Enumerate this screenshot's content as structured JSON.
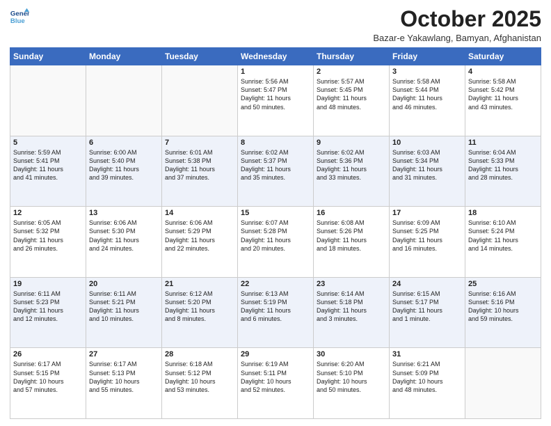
{
  "header": {
    "logo_line1": "General",
    "logo_line2": "Blue",
    "month": "October 2025",
    "location": "Bazar-e Yakawlang, Bamyan, Afghanistan"
  },
  "weekdays": [
    "Sunday",
    "Monday",
    "Tuesday",
    "Wednesday",
    "Thursday",
    "Friday",
    "Saturday"
  ],
  "weeks": [
    [
      {
        "day": "",
        "info": ""
      },
      {
        "day": "",
        "info": ""
      },
      {
        "day": "",
        "info": ""
      },
      {
        "day": "1",
        "info": "Sunrise: 5:56 AM\nSunset: 5:47 PM\nDaylight: 11 hours\nand 50 minutes."
      },
      {
        "day": "2",
        "info": "Sunrise: 5:57 AM\nSunset: 5:45 PM\nDaylight: 11 hours\nand 48 minutes."
      },
      {
        "day": "3",
        "info": "Sunrise: 5:58 AM\nSunset: 5:44 PM\nDaylight: 11 hours\nand 46 minutes."
      },
      {
        "day": "4",
        "info": "Sunrise: 5:58 AM\nSunset: 5:42 PM\nDaylight: 11 hours\nand 43 minutes."
      }
    ],
    [
      {
        "day": "5",
        "info": "Sunrise: 5:59 AM\nSunset: 5:41 PM\nDaylight: 11 hours\nand 41 minutes."
      },
      {
        "day": "6",
        "info": "Sunrise: 6:00 AM\nSunset: 5:40 PM\nDaylight: 11 hours\nand 39 minutes."
      },
      {
        "day": "7",
        "info": "Sunrise: 6:01 AM\nSunset: 5:38 PM\nDaylight: 11 hours\nand 37 minutes."
      },
      {
        "day": "8",
        "info": "Sunrise: 6:02 AM\nSunset: 5:37 PM\nDaylight: 11 hours\nand 35 minutes."
      },
      {
        "day": "9",
        "info": "Sunrise: 6:02 AM\nSunset: 5:36 PM\nDaylight: 11 hours\nand 33 minutes."
      },
      {
        "day": "10",
        "info": "Sunrise: 6:03 AM\nSunset: 5:34 PM\nDaylight: 11 hours\nand 31 minutes."
      },
      {
        "day": "11",
        "info": "Sunrise: 6:04 AM\nSunset: 5:33 PM\nDaylight: 11 hours\nand 28 minutes."
      }
    ],
    [
      {
        "day": "12",
        "info": "Sunrise: 6:05 AM\nSunset: 5:32 PM\nDaylight: 11 hours\nand 26 minutes."
      },
      {
        "day": "13",
        "info": "Sunrise: 6:06 AM\nSunset: 5:30 PM\nDaylight: 11 hours\nand 24 minutes."
      },
      {
        "day": "14",
        "info": "Sunrise: 6:06 AM\nSunset: 5:29 PM\nDaylight: 11 hours\nand 22 minutes."
      },
      {
        "day": "15",
        "info": "Sunrise: 6:07 AM\nSunset: 5:28 PM\nDaylight: 11 hours\nand 20 minutes."
      },
      {
        "day": "16",
        "info": "Sunrise: 6:08 AM\nSunset: 5:26 PM\nDaylight: 11 hours\nand 18 minutes."
      },
      {
        "day": "17",
        "info": "Sunrise: 6:09 AM\nSunset: 5:25 PM\nDaylight: 11 hours\nand 16 minutes."
      },
      {
        "day": "18",
        "info": "Sunrise: 6:10 AM\nSunset: 5:24 PM\nDaylight: 11 hours\nand 14 minutes."
      }
    ],
    [
      {
        "day": "19",
        "info": "Sunrise: 6:11 AM\nSunset: 5:23 PM\nDaylight: 11 hours\nand 12 minutes."
      },
      {
        "day": "20",
        "info": "Sunrise: 6:11 AM\nSunset: 5:21 PM\nDaylight: 11 hours\nand 10 minutes."
      },
      {
        "day": "21",
        "info": "Sunrise: 6:12 AM\nSunset: 5:20 PM\nDaylight: 11 hours\nand 8 minutes."
      },
      {
        "day": "22",
        "info": "Sunrise: 6:13 AM\nSunset: 5:19 PM\nDaylight: 11 hours\nand 6 minutes."
      },
      {
        "day": "23",
        "info": "Sunrise: 6:14 AM\nSunset: 5:18 PM\nDaylight: 11 hours\nand 3 minutes."
      },
      {
        "day": "24",
        "info": "Sunrise: 6:15 AM\nSunset: 5:17 PM\nDaylight: 11 hours\nand 1 minute."
      },
      {
        "day": "25",
        "info": "Sunrise: 6:16 AM\nSunset: 5:16 PM\nDaylight: 10 hours\nand 59 minutes."
      }
    ],
    [
      {
        "day": "26",
        "info": "Sunrise: 6:17 AM\nSunset: 5:15 PM\nDaylight: 10 hours\nand 57 minutes."
      },
      {
        "day": "27",
        "info": "Sunrise: 6:17 AM\nSunset: 5:13 PM\nDaylight: 10 hours\nand 55 minutes."
      },
      {
        "day": "28",
        "info": "Sunrise: 6:18 AM\nSunset: 5:12 PM\nDaylight: 10 hours\nand 53 minutes."
      },
      {
        "day": "29",
        "info": "Sunrise: 6:19 AM\nSunset: 5:11 PM\nDaylight: 10 hours\nand 52 minutes."
      },
      {
        "day": "30",
        "info": "Sunrise: 6:20 AM\nSunset: 5:10 PM\nDaylight: 10 hours\nand 50 minutes."
      },
      {
        "day": "31",
        "info": "Sunrise: 6:21 AM\nSunset: 5:09 PM\nDaylight: 10 hours\nand 48 minutes."
      },
      {
        "day": "",
        "info": ""
      }
    ]
  ]
}
